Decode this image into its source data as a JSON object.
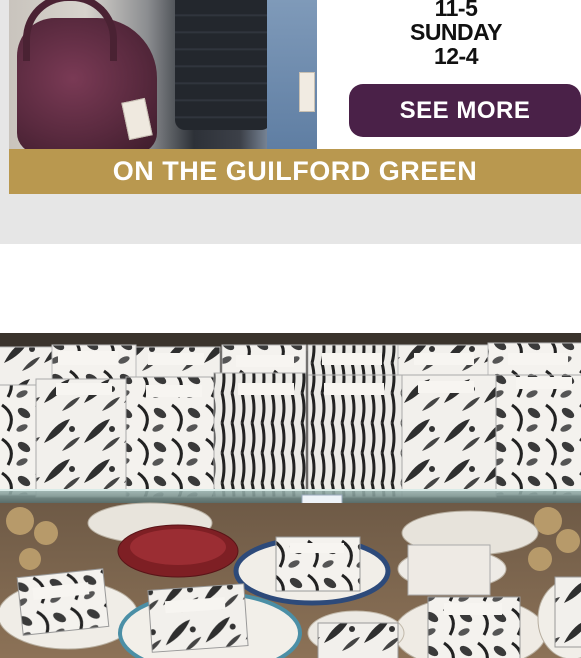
{
  "ad": {
    "hours_line1": "11-5",
    "hours_line2": "SUNDAY",
    "hours_line3": "12-4",
    "button_label": "SEE MORE",
    "location": "ON THE GUILFORD GREEN",
    "colors": {
      "button": "#4a2148",
      "strip": "#b9984f",
      "backdrop": "#e6e6e6"
    }
  },
  "photo": {
    "subject": "shop display of wrapped soap bars on a glass shelf above assorted plates"
  }
}
